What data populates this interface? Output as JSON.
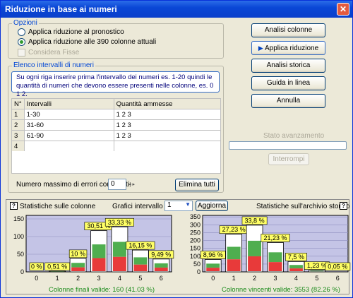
{
  "window": {
    "title": "Riduzione in base ai numeri",
    "close_glyph": "✕"
  },
  "options": {
    "legend": "Opzioni",
    "radio1": "Applica riduzione al pronostico",
    "radio2": "Applica riduzione alle 390 colonne attuali",
    "check": "Considera Fisse"
  },
  "buttons": {
    "analisi": "Analisi colonne",
    "applica": "Applica riduzione",
    "storica": "Analisi storica",
    "guida": "Guida in linea",
    "annulla": "Annulla",
    "interrompi": "Interrompi",
    "elimina": "Elimina tutti",
    "aggiorna": "Aggiorna"
  },
  "progress": {
    "label": "Stato avanzamento"
  },
  "intervals": {
    "legend": "Elenco intervalli di numeri",
    "note": "Su ogni riga inserire prima l'intervallo dei numeri es. 1-20 quindi le quantità di numeri che devono essere presenti nelle colonne, es. 0 1 2.",
    "headers": [
      "N°",
      "Intervalli",
      "Quantità ammesse"
    ],
    "rows": [
      {
        "n": "1",
        "intervallo": "1-30",
        "quantita": "1 2 3"
      },
      {
        "n": "2",
        "intervallo": "31-60",
        "quantita": "1 2 3"
      },
      {
        "n": "3",
        "intervallo": "61-90",
        "quantita": "1 2 3"
      },
      {
        "n": "4",
        "intervallo": "",
        "quantita": ""
      }
    ]
  },
  "errors": {
    "label": "Numero massimo di errori consentiti:",
    "value": "0",
    "spin": "◂ ▸"
  },
  "stats": {
    "help_glyph": "?",
    "left_title": "Statistiche sulle colonne",
    "grafici_label": "Grafici intervallo N°",
    "grafici_value": "1",
    "right_title": "Statistiche sull'archivio storico",
    "left_footer": "Colonne finali valide: 160 (41.03 %)",
    "right_footer": "Colonne vincenti valide: 3553 (82.26 %)"
  },
  "chart_data": [
    {
      "type": "bar",
      "categories": [
        "0",
        "1",
        "2",
        "3",
        "4",
        "5",
        "6"
      ],
      "values": [
        0,
        0.51,
        10,
        30.51,
        33.33,
        16.15,
        9.49
      ],
      "labels": [
        "0 %",
        "0,51 %",
        "10 %",
        "30,51 %",
        "33,33 %",
        "16,15 %",
        "9,49 %"
      ],
      "yticks": [
        0,
        50,
        100,
        150
      ],
      "ylim": [
        0,
        160
      ]
    },
    {
      "type": "bar",
      "categories": [
        "0",
        "1",
        "2",
        "3",
        "4",
        "5",
        "6"
      ],
      "values": [
        8.96,
        27.23,
        33.8,
        21.23,
        7.5,
        1.23,
        0.05
      ],
      "labels": [
        "8,96 %",
        "27,23 %",
        "33,8 %",
        "21,23 %",
        "7,5 %",
        "1,23 %",
        "0,05 %"
      ],
      "yticks": [
        0,
        50,
        100,
        150,
        200,
        250,
        300,
        350
      ],
      "ylim": [
        0,
        360
      ]
    }
  ]
}
